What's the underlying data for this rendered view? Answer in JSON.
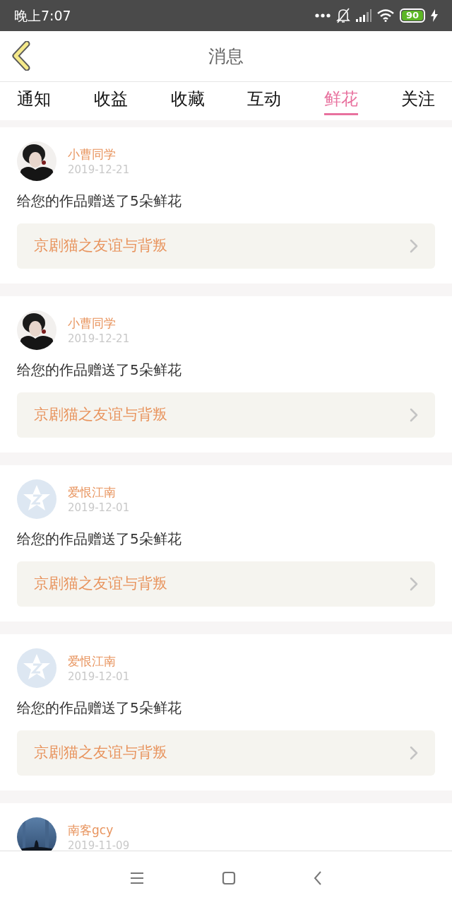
{
  "status_bar": {
    "time": "晚上7:07",
    "battery": "90"
  },
  "header": {
    "title": "消息"
  },
  "tabs": [
    {
      "label": "通知",
      "selected": false
    },
    {
      "label": "收益",
      "selected": false
    },
    {
      "label": "收藏",
      "selected": false
    },
    {
      "label": "互动",
      "selected": false
    },
    {
      "label": "鲜花",
      "selected": true
    },
    {
      "label": "关注",
      "selected": false
    }
  ],
  "messages": [
    {
      "name": "小曹同学",
      "date": "2019-12-21",
      "text": "给您的作品赠送了5朵鲜花",
      "work": "京剧猫之友谊与背叛"
    },
    {
      "name": "小曹同学",
      "date": "2019-12-21",
      "text": "给您的作品赠送了5朵鲜花",
      "work": "京剧猫之友谊与背叛"
    },
    {
      "avatar": {
        "kind": "default"
      },
      "name": "爱恨江南",
      "date": "2019-12-01",
      "text": "给您的作品赠送了5朵鲜花",
      "work": "京剧猫之友谊与背叛"
    },
    {
      "avatar": {
        "kind": "default"
      },
      "name": "爱恨江南",
      "date": "2019-12-01",
      "text": "给您的作品赠送了5朵鲜花",
      "work": "京剧猫之友谊与背叛"
    },
    {
      "name": "南客gcy",
      "date": "2019-11-09"
    }
  ]
}
